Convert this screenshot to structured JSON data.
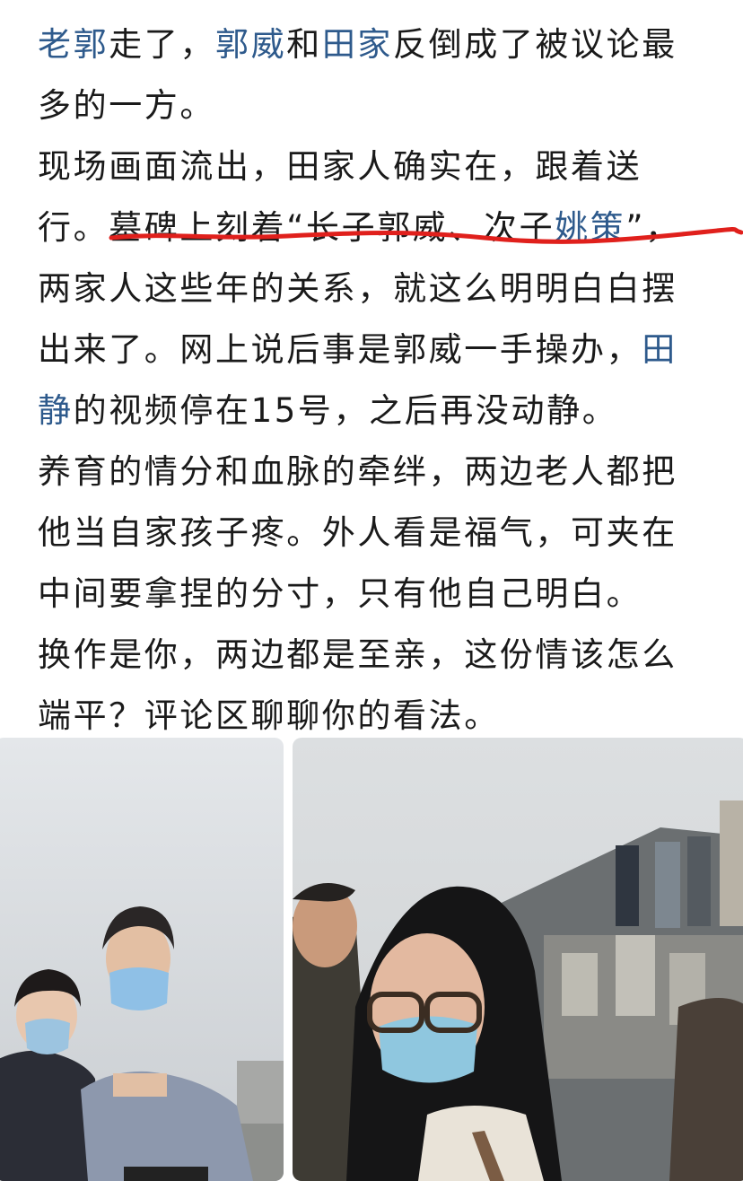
{
  "post": {
    "p1": {
      "link_1": "老郭",
      "text_1": "走了，",
      "link_2": "郭威",
      "text_2": "和",
      "link_3": "田家",
      "text_3": "反倒成了被议论最多的一方。"
    },
    "p2": {
      "text_1": "现场画面流出，田家人确实在，跟着送行。墓碑上刻着“长子郭威、次子",
      "link_1": "姚策",
      "text_2": "”，两家人这些年的关系，就这么明明白白摆出来了。网上说后事是郭威一手操办，",
      "link_2": "田静",
      "text_3": "的视频停在15号，之后再没动静。"
    },
    "p3": "养育的情分和血脉的牵绊，两边老人都把他当自家孩子疼。外人看是福气，可夹在中间要拿捏的分寸，只有他自己明白。",
    "p4": "换作是你，两边都是至亲，这份情该怎么端平？评论区聊聊你的看法。"
  },
  "colors": {
    "link": "#2e5a8c",
    "body_text": "#1a1a1a",
    "underline": "#e0201c"
  },
  "photos": [
    {
      "name": "photo-couple-masks"
    },
    {
      "name": "photo-cemetery-crowd"
    }
  ]
}
